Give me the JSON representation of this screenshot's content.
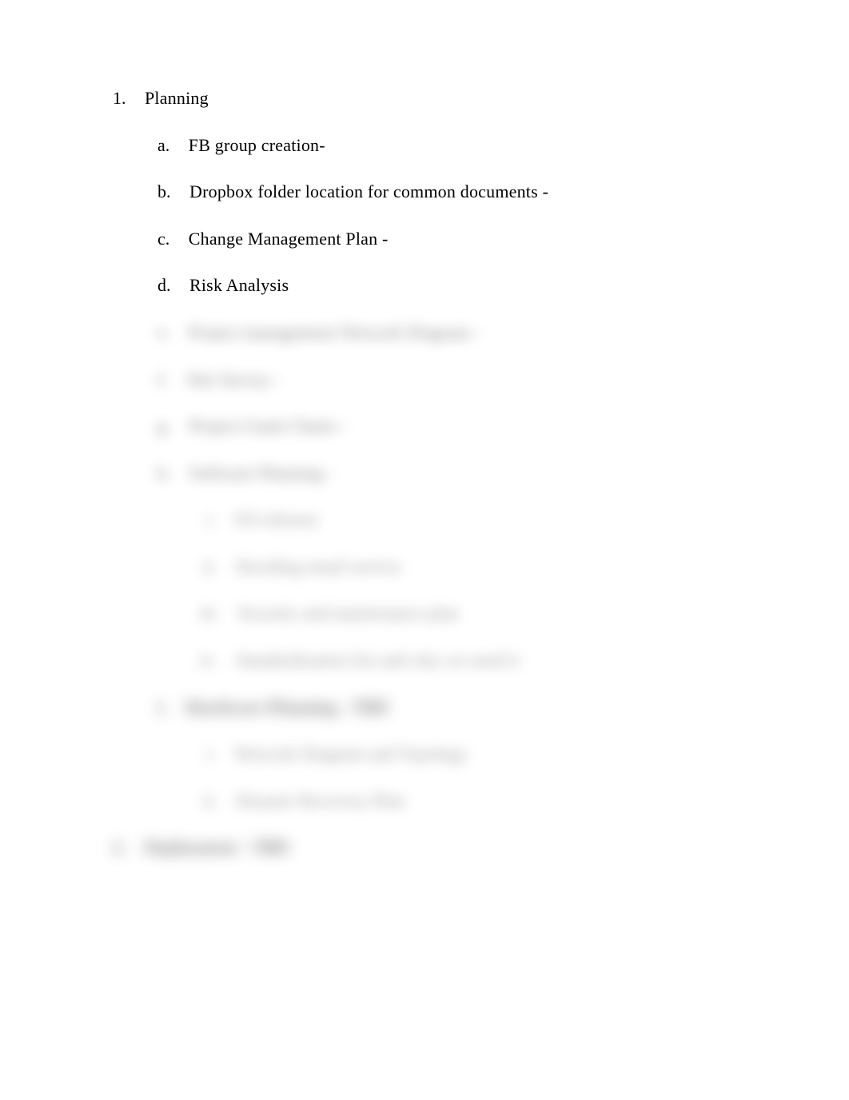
{
  "outline": {
    "l1": {
      "num": "1.",
      "text": "Planning",
      "children": {
        "a": {
          "marker": "a.",
          "text": "FB group creation-"
        },
        "b": {
          "marker": "b.",
          "text": "Dropbox folder location for common documents -"
        },
        "c": {
          "marker": "c.",
          "text": "Change Management Plan -"
        },
        "d": {
          "marker": "d.",
          "text": "Risk Analysis"
        },
        "e": {
          "marker": "e.",
          "text": "Project management Network Diagram -"
        },
        "f": {
          "marker": "f.",
          "text": "Site Survey -"
        },
        "g": {
          "marker": "g.",
          "text": "Project Gantt Charts -"
        },
        "h": {
          "marker": "h.",
          "text": "Software Planning -",
          "children": {
            "i": {
              "marker": "i.",
              "text": "OS releases"
            },
            "ii": {
              "marker": "ii.",
              "text": "Deciding email service"
            },
            "iii": {
              "marker": "iii.",
              "text": "Security and maintenance plan"
            },
            "iv": {
              "marker": "iv.",
              "text": "Standardization list and why we need it"
            }
          }
        },
        "i": {
          "marker": "i.",
          "text": "Hardware Planning - TBD",
          "children": {
            "i": {
              "marker": "i.",
              "text": "Network Diagram and Topology"
            },
            "ii": {
              "marker": "ii.",
              "text": "Disaster Recovery Plan"
            }
          }
        }
      }
    },
    "l2": {
      "num": "2.",
      "text": "Deployment - TBD"
    }
  }
}
